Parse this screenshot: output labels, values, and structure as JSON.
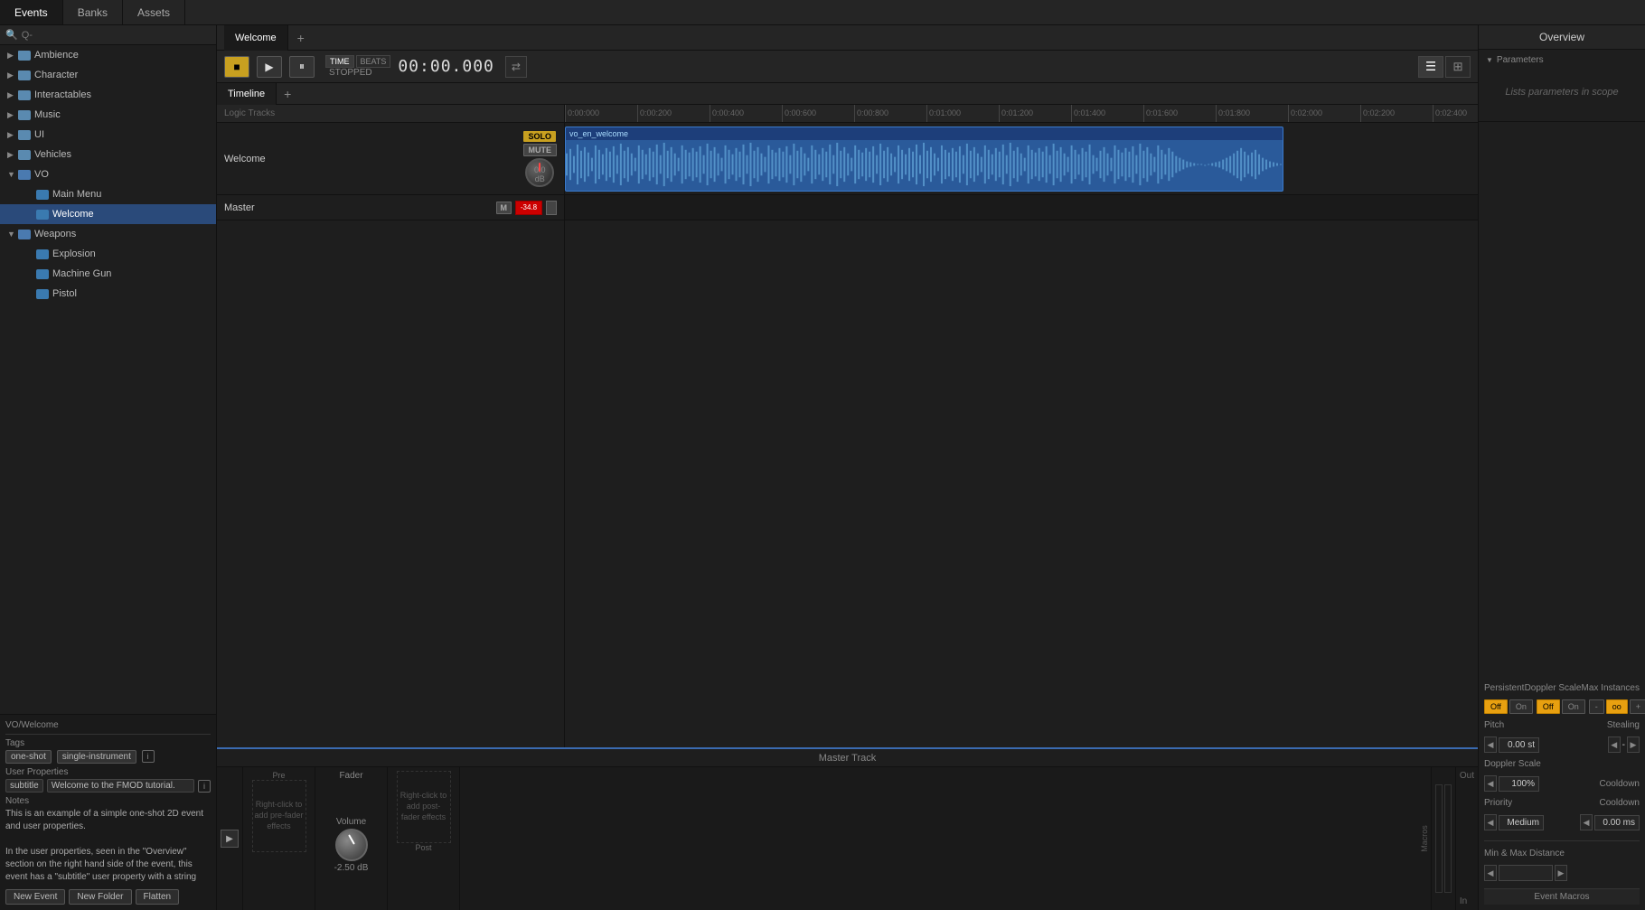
{
  "top_tabs": {
    "events_label": "Events",
    "banks_label": "Banks",
    "assets_label": "Assets"
  },
  "sidebar": {
    "search_placeholder": "Q-",
    "tree": [
      {
        "id": "ambience",
        "label": "Ambience",
        "level": 0,
        "type": "folder",
        "expanded": false
      },
      {
        "id": "character",
        "label": "Character",
        "level": 0,
        "type": "folder",
        "expanded": false
      },
      {
        "id": "interactables",
        "label": "Interactables",
        "level": 0,
        "type": "folder",
        "expanded": false
      },
      {
        "id": "music",
        "label": "Music",
        "level": 0,
        "type": "folder",
        "expanded": false
      },
      {
        "id": "ui",
        "label": "UI",
        "level": 0,
        "type": "folder",
        "expanded": false
      },
      {
        "id": "vehicles",
        "label": "Vehicles",
        "level": 0,
        "type": "folder",
        "expanded": false
      },
      {
        "id": "vo",
        "label": "VO",
        "level": 0,
        "type": "folder",
        "expanded": true
      },
      {
        "id": "main-menu",
        "label": "Main Menu",
        "level": 1,
        "type": "event",
        "expanded": false
      },
      {
        "id": "welcome",
        "label": "Welcome",
        "level": 1,
        "type": "event",
        "expanded": false,
        "selected": true
      },
      {
        "id": "weapons",
        "label": "Weapons",
        "level": 0,
        "type": "folder",
        "expanded": true
      },
      {
        "id": "explosion",
        "label": "Explosion",
        "level": 1,
        "type": "event"
      },
      {
        "id": "machine-gun",
        "label": "Machine Gun",
        "level": 1,
        "type": "event"
      },
      {
        "id": "pistol",
        "label": "Pistol",
        "level": 1,
        "type": "event"
      }
    ],
    "bottom": {
      "path": "VO/Welcome",
      "tags_label": "Tags",
      "tags": [
        "one-shot",
        "single-instrument"
      ],
      "user_props_label": "User Properties",
      "user_prop_key": "subtitle",
      "user_prop_value": "Welcome to the FMOD tutorial.",
      "notes_label": "Notes",
      "notes_text": "This is an example of a simple one-shot 2D event and user properties.\n\nIn the user properties, seen in the \"Overview\" section on the right hand side of the event, this event has a \"subtitle\" user property with a string",
      "btn_new_event": "New Event",
      "btn_new_folder": "New Folder",
      "btn_flatten": "Flatten"
    }
  },
  "event_area": {
    "welcome_tab": "Welcome",
    "plus_tab": "+",
    "transport": {
      "time_label": "TIME",
      "beats_label": "BEATS",
      "stopped_label": "STOPPED",
      "time_value": "00:00.000"
    },
    "timeline_tab": "Timeline",
    "logic_tracks_label": "Logic Tracks",
    "track_name": "Welcome",
    "solo_label": "SOLO",
    "mute_label": "MUTE",
    "db_label": "0.0 dB",
    "master_label": "Master",
    "clip_name": "vo_en_welcome",
    "master_track_label": "Master Track"
  },
  "right_panel": {
    "header": "Overview",
    "params_section_label": "Parameters",
    "params_hint": "Lists parameters in scope"
  },
  "bottom_right": {
    "persistent_label": "Persistent",
    "doppler_label": "Doppler Scale",
    "max_instances_label": "Max Instances",
    "off_label": "Off",
    "on_label": "On",
    "dash_label": "oo",
    "pitch_label": "Pitch",
    "stealing_label": "Stealing",
    "pitch_value": "0.00 st",
    "doppler_value": "100%",
    "stealing_dash": "-",
    "priority_label": "Priority",
    "cooldown_label": "Cooldown",
    "priority_value": "Medium",
    "cooldown_value": "0.00 ms",
    "min_max_dist_label": "Min & Max Distance",
    "event_macros_label": "Event Macros",
    "fader_label": "Fader",
    "volume_label": "Volume",
    "volume_value": "-2.50 dB",
    "pre_label": "Pre",
    "post_label": "Post",
    "in_label": "In",
    "out_label": "Out",
    "macros_label": "Macros",
    "right_click_pre": "Right-click to add pre-fader effects",
    "right_click_post": "Right-click to add post-fader effects"
  },
  "colors": {
    "accent_blue": "#3a6ab0",
    "accent_yellow": "#c8a020",
    "waveform_blue": "#2a5a9a"
  }
}
